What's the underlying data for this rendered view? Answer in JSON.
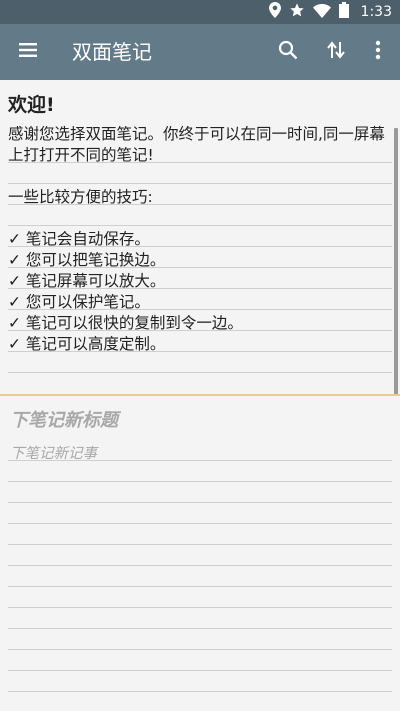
{
  "status_bar": {
    "time": "1:33",
    "icons": [
      "location-icon",
      "star-icon",
      "wifi-icon",
      "battery-icon"
    ]
  },
  "toolbar": {
    "title": "双面笔记",
    "menu_icon": "menu-icon",
    "search_icon": "search-icon",
    "swap_icon": "swap-icon",
    "more_icon": "more-icon"
  },
  "top_note": {
    "title": "欢迎!",
    "body": "感谢您选择双面笔记。你终于可以在同一时间,同一屏幕上打打开不同的笔记!\n\n一些比较方便的技巧:\n\n✓ 笔记会自动保存。\n✓ 您可以把笔记换边。\n✓ 笔记屏幕可以放大。\n✓ 您可以保护笔记。\n✓ 笔记可以很快的复制到令一边。\n✓ 笔记可以高度定制。"
  },
  "bottom_note": {
    "title_placeholder": "下笔记新标题",
    "body_placeholder": "下笔记新记事"
  },
  "colors": {
    "status_bar": "#4c5f6a",
    "toolbar": "#637a88",
    "divider": "#f1c79a"
  }
}
